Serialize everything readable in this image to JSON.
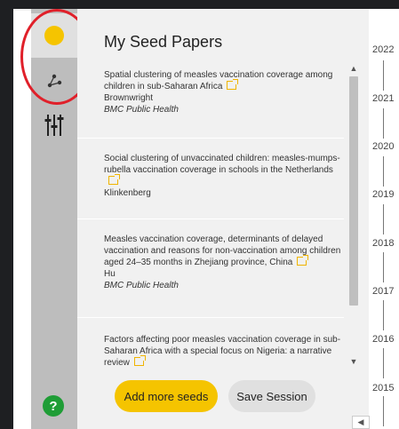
{
  "sidebar": {
    "items": [
      {
        "icon": "circle-logo-icon",
        "active": true
      },
      {
        "icon": "network-graph-icon",
        "active": false
      },
      {
        "icon": "sliders-icon",
        "active": false
      }
    ],
    "help_label": "?"
  },
  "panel": {
    "title": "My Seed Papers",
    "papers": [
      {
        "title": "Spatial clustering of measles vaccination coverage among children in sub-Saharan Africa",
        "author": "Brownwright",
        "journal": "BMC Public Health"
      },
      {
        "title": "Social clustering of unvaccinated children: measles-mumps-rubella vaccination coverage in schools in the Netherlands",
        "author": "Klinkenberg",
        "journal": ""
      },
      {
        "title": "Measles vaccination coverage, determinants of delayed vaccination and reasons for non-vaccination among children aged 24–35 months in Zhejiang province, China",
        "author": "Hu",
        "journal": "BMC Public Health"
      },
      {
        "title": "Factors affecting poor measles vaccination coverage in sub-Saharan Africa with a special focus on Nigeria: a narrative review",
        "author": "",
        "journal": ""
      }
    ],
    "add_button": "Add more seeds",
    "save_button": "Save Session"
  },
  "timeline": {
    "years": [
      "2022",
      "2021",
      "2020",
      "2019",
      "2018",
      "2017",
      "2016",
      "2015"
    ]
  },
  "colors": {
    "accent": "#f5c400",
    "help": "#1f9d36",
    "annotation": "#e0202a"
  }
}
